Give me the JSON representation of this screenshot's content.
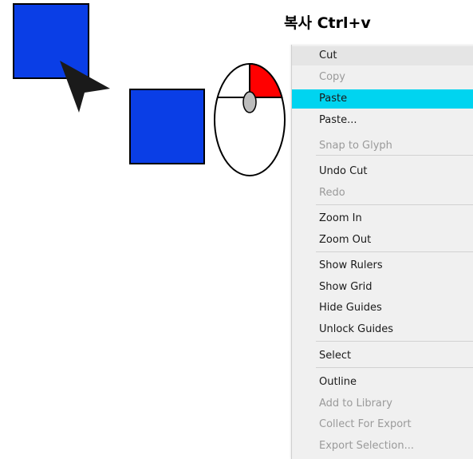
{
  "caption": "복사 Ctrl+v",
  "colors": {
    "square_fill": "#0a3ee6",
    "mouse_button_highlight": "#ff0000",
    "menu_background": "#f0f0f0",
    "menu_selected": "#00d4f0",
    "menu_disabled_text": "#9a9a9a"
  },
  "icons": {
    "cursor": "arrow-cursor-icon",
    "mouse": "mouse-right-click-icon"
  },
  "menu": {
    "items": [
      {
        "label": "Cut",
        "state": "hovered"
      },
      {
        "label": "Copy",
        "state": "disabled"
      },
      {
        "label": "Paste",
        "state": "selected"
      },
      {
        "label": "Paste...",
        "state": "enabled",
        "submenu": true
      },
      {
        "label": "Snap to Glyph",
        "state": "disabled"
      },
      {
        "label": "Undo Cut",
        "state": "enabled"
      },
      {
        "label": "Redo",
        "state": "disabled"
      },
      {
        "label": "Zoom In",
        "state": "enabled"
      },
      {
        "label": "Zoom Out",
        "state": "enabled"
      },
      {
        "label": "Show Rulers",
        "state": "enabled"
      },
      {
        "label": "Show Grid",
        "state": "enabled"
      },
      {
        "label": "Hide Guides",
        "state": "enabled"
      },
      {
        "label": "Unlock Guides",
        "state": "enabled"
      },
      {
        "label": "Select",
        "state": "enabled",
        "submenu": true
      },
      {
        "label": "Outline",
        "state": "enabled"
      },
      {
        "label": "Add to Library",
        "state": "disabled"
      },
      {
        "label": "Collect For Export",
        "state": "disabled",
        "submenu": true
      },
      {
        "label": "Export Selection...",
        "state": "disabled"
      }
    ],
    "submenu_glyph": "›"
  }
}
